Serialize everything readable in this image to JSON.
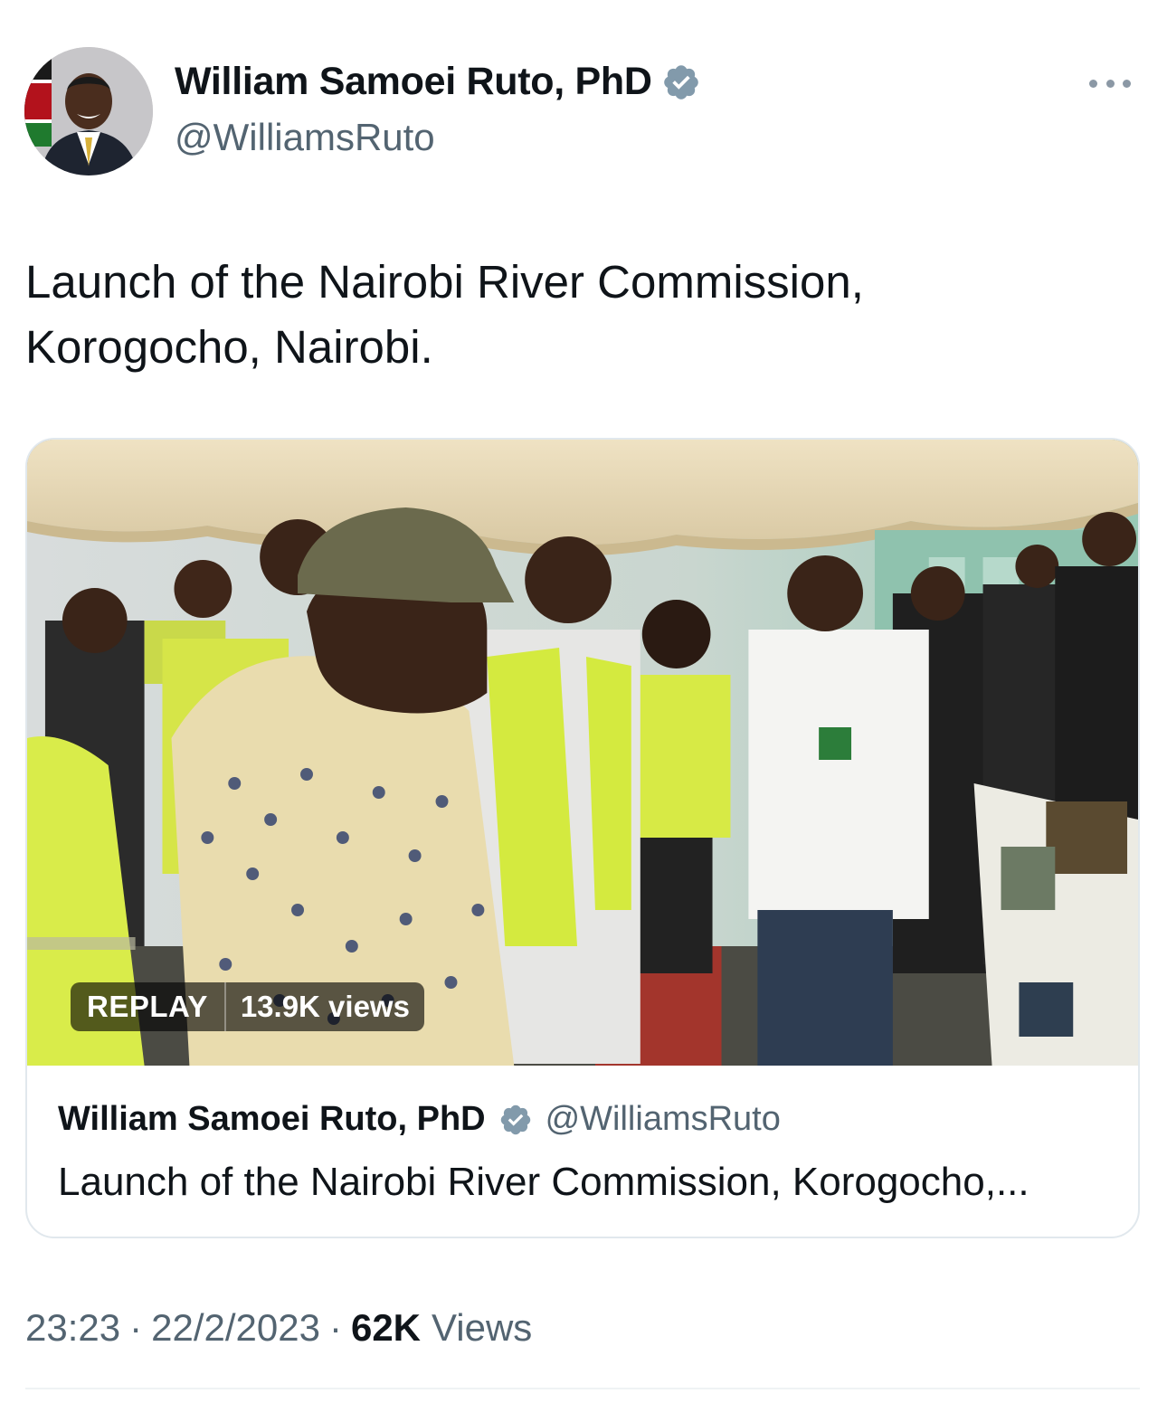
{
  "author": {
    "display_name": "William Samoei Ruto, PhD",
    "handle": "@WilliamsRuto",
    "verified": true
  },
  "menu": {
    "icon": "more-horizontal-icon"
  },
  "tweet": {
    "text_line1": "Launch of the Nairobi River Commission,",
    "text_line2": "Korogocho, Nairobi."
  },
  "quoted": {
    "display_name": "William Samoei Ruto, PhD",
    "handle": "@WilliamsRuto",
    "text": "Launch of the Nairobi River Commission, Korogocho,...",
    "video": {
      "replay_label": "REPLAY",
      "views_label": "13.9K views"
    }
  },
  "footer": {
    "time": "23:23",
    "date": "22/2/2023",
    "views_count": "62K",
    "views_label": "Views"
  },
  "colors": {
    "verified_badge": "#829aab",
    "secondary_text": "#536471",
    "primary_text": "#0f1419"
  }
}
